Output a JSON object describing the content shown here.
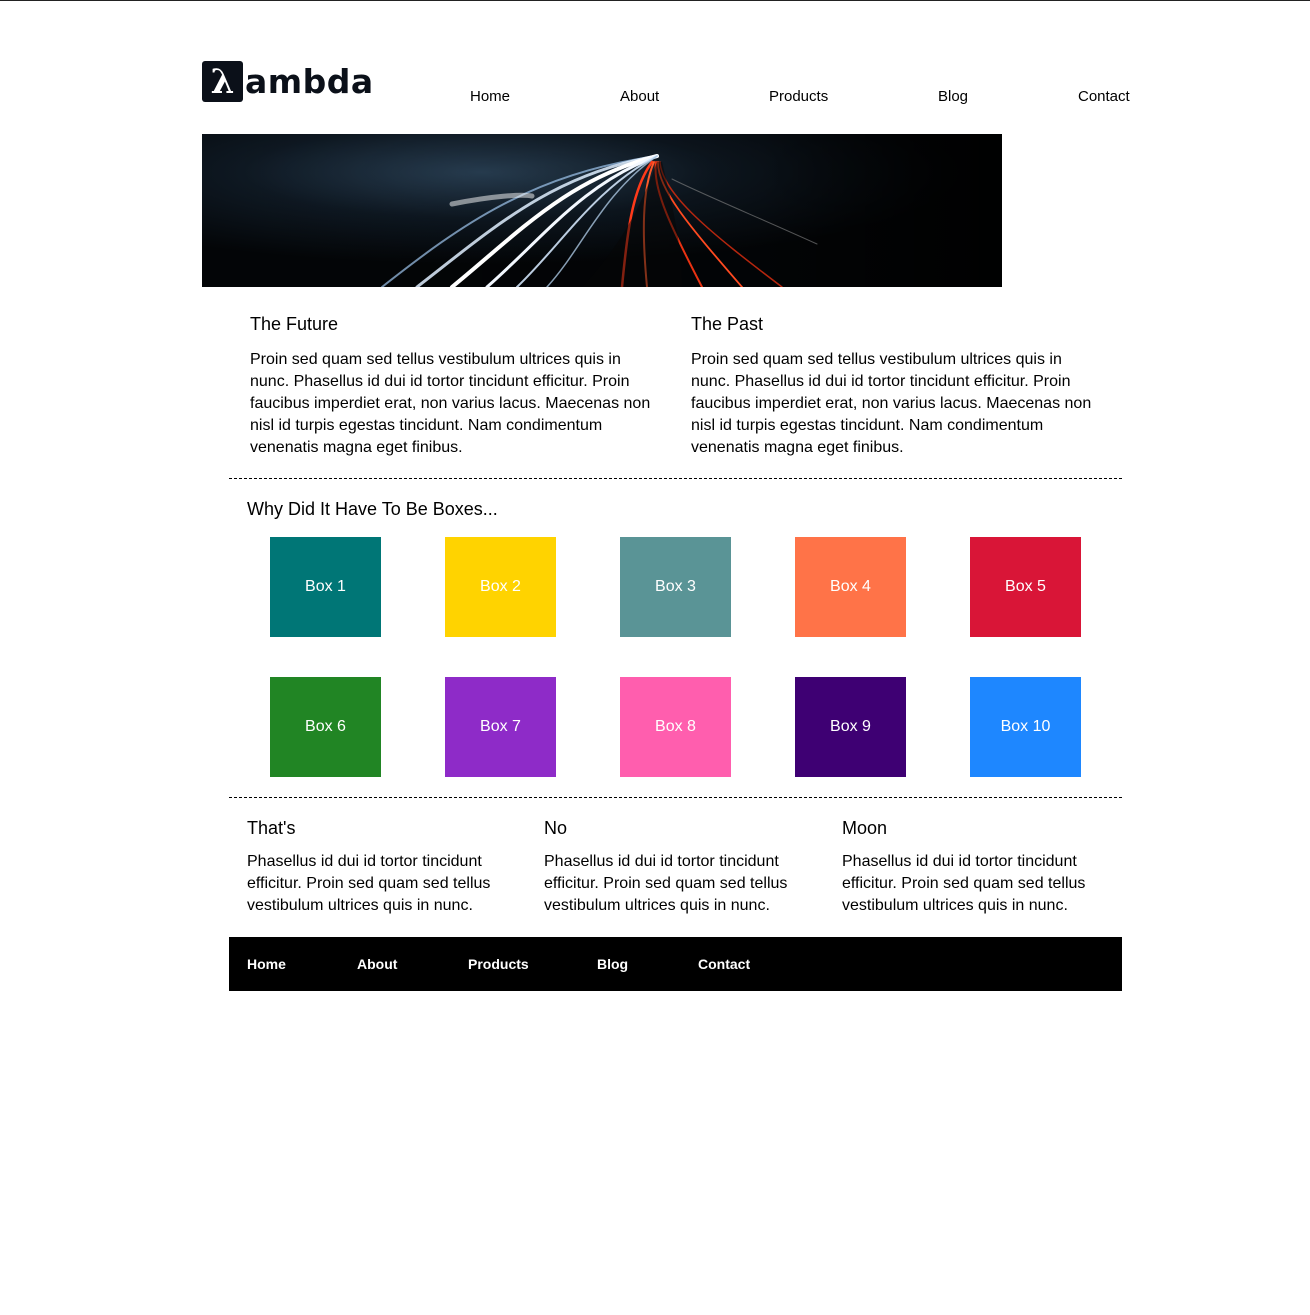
{
  "brand": {
    "logo_symbol": "λ",
    "logo_text": "ambda"
  },
  "nav": [
    "Home",
    "About",
    "Products",
    "Blog",
    "Contact"
  ],
  "articles": [
    {
      "title": "The Future",
      "body": "Proin sed quam sed tellus vestibulum ultrices quis in nunc. Phasellus id dui id tortor tincidunt efficitur. Proin faucibus imperdiet erat, non varius lacus. Maecenas non nisl id turpis egestas tincidunt. Nam condimentum venenatis magna eget finibus."
    },
    {
      "title": "The Past",
      "body": "Proin sed quam sed tellus vestibulum ultrices quis in nunc. Phasellus id dui id tortor tincidunt efficitur. Proin faucibus imperdiet erat, non varius lacus. Maecenas non nisl id turpis egestas tincidunt. Nam condimentum venenatis magna eget finibus."
    }
  ],
  "boxes_title": "Why Did It Have To Be Boxes...",
  "boxes": [
    {
      "label": "Box 1",
      "color": "#007676"
    },
    {
      "label": "Box 2",
      "color": "#ffd300"
    },
    {
      "label": "Box 3",
      "color": "#5a9496"
    },
    {
      "label": "Box 4",
      "color": "#ff7348"
    },
    {
      "label": "Box 5",
      "color": "#d91537"
    },
    {
      "label": "Box 6",
      "color": "#218524"
    },
    {
      "label": "Box 7",
      "color": "#8e2bc8"
    },
    {
      "label": "Box 8",
      "color": "#ff5eae"
    },
    {
      "label": "Box 9",
      "color": "#3e0073"
    },
    {
      "label": "Box 10",
      "color": "#1e87ff"
    }
  ],
  "columns": [
    {
      "title": "That's",
      "body": "Phasellus id dui id tortor tincidunt efficitur. Proin sed quam sed tellus vestibulum ultrices quis in nunc."
    },
    {
      "title": "No",
      "body": "Phasellus id dui id tortor tincidunt efficitur. Proin sed quam sed tellus vestibulum ultrices quis in nunc."
    },
    {
      "title": "Moon",
      "body": "Phasellus id dui id tortor tincidunt efficitur. Proin sed quam sed tellus vestibulum ultrices quis in nunc."
    }
  ],
  "footer_nav": [
    "Home",
    "About",
    "Products",
    "Blog",
    "Contact"
  ]
}
